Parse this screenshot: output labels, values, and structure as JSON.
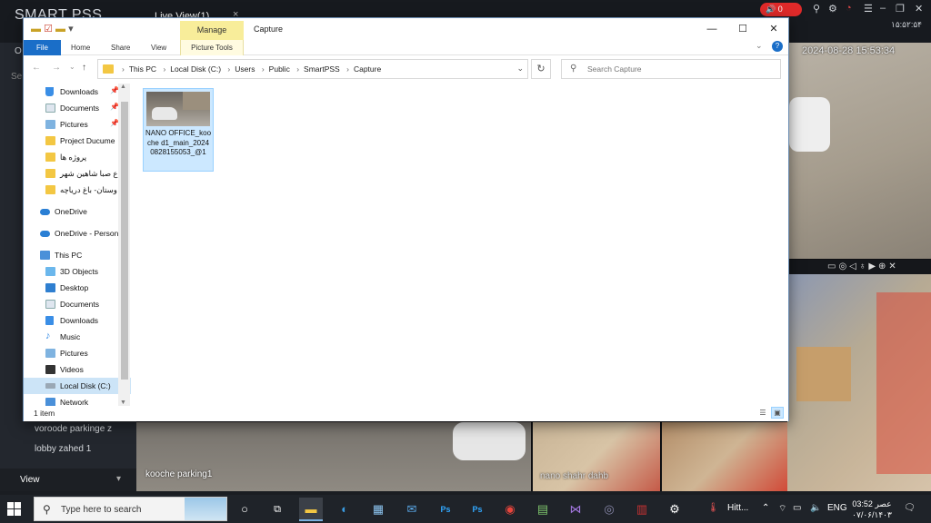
{
  "smartpss": {
    "logo": "SMART PSS",
    "tab_label": "Live View(1)",
    "tab_close": "×",
    "alarm_icon": "speaker-icon",
    "alarm_count": "0",
    "top_icons": [
      "pin-icon",
      "gear-icon",
      "gauge-icon",
      "menu-icon"
    ],
    "window_controls": [
      "minimize-icon",
      "restore-icon",
      "close-icon"
    ],
    "datetime": "۱۵:۵۲:۵۴",
    "left_items": [
      {
        "label": "O"
      },
      {
        "label": "Se"
      },
      {
        "label": "voroode parkinge z"
      },
      {
        "label": "lobby zahed 1"
      }
    ],
    "view_label": "View",
    "view_arrow": "▾",
    "cameras": [
      {
        "label": "kooche parking1"
      },
      {
        "label": "nano shahr dahb"
      }
    ],
    "overlay_timestamp": "2024-08-28 15:53:34"
  },
  "explorer": {
    "title": "Capture",
    "contextual_tab": "Manage",
    "contextual_subtab": "Picture Tools",
    "ribbon_tabs": [
      "File",
      "Home",
      "Share",
      "View"
    ],
    "breadcrumb": [
      "This PC",
      "Local Disk (C:)",
      "Users",
      "Public",
      "SmartPSS",
      "Capture"
    ],
    "search_placeholder": "Search Capture",
    "nav_items": [
      {
        "label": "Downloads",
        "pinned": true,
        "icon": "download-icon"
      },
      {
        "label": "Documents",
        "pinned": true,
        "icon": "documents-icon"
      },
      {
        "label": "Pictures",
        "pinned": true,
        "icon": "pictures-icon"
      },
      {
        "label": "Project Ducume",
        "pinned": false,
        "icon": "folder-icon"
      },
      {
        "label": "پروژه ها",
        "pinned": false,
        "icon": "folder-icon"
      },
      {
        "label": "ع صبا شاهین شهر",
        "pinned": false,
        "icon": "folder-icon"
      },
      {
        "label": "وستان- باغ دریاچه",
        "pinned": false,
        "icon": "folder-icon"
      },
      {
        "label": "OneDrive",
        "pinned": false,
        "icon": "onedrive-icon"
      },
      {
        "label": "OneDrive - Person",
        "pinned": false,
        "icon": "onedrive-icon"
      },
      {
        "label": "This PC",
        "pinned": false,
        "icon": "pc-icon"
      },
      {
        "label": "3D Objects",
        "pinned": false,
        "icon": "cube-icon"
      },
      {
        "label": "Desktop",
        "pinned": false,
        "icon": "desktop-icon"
      },
      {
        "label": "Documents",
        "pinned": false,
        "icon": "documents-icon"
      },
      {
        "label": "Downloads",
        "pinned": false,
        "icon": "download-icon"
      },
      {
        "label": "Music",
        "pinned": false,
        "icon": "music-icon"
      },
      {
        "label": "Pictures",
        "pinned": false,
        "icon": "pictures-icon"
      },
      {
        "label": "Videos",
        "pinned": false,
        "icon": "videos-icon"
      },
      {
        "label": "Local Disk (C:)",
        "pinned": false,
        "icon": "disk-icon",
        "selected": true
      },
      {
        "label": "Network",
        "pinned": false,
        "icon": "network-icon"
      }
    ],
    "files": [
      {
        "name": "NANO OFFICE_kooche d1_main_20240828155053_@1"
      }
    ],
    "status": "1 item"
  },
  "taskbar": {
    "search_placeholder": "Type here to search",
    "apps": [
      "cortana-icon",
      "task-view-icon",
      "file-explorer-icon",
      "edge-icon",
      "store-icon",
      "mail-icon",
      "photoshop-icon",
      "photoshop-icon",
      "chrome-icon",
      "notepad-icon",
      "visual-studio-icon",
      "camera-icon",
      "winrar-icon",
      "settings-icon"
    ],
    "weather_label": "Hitt...",
    "language": "ENG",
    "time": "03:52 عصر",
    "date": "۰۷/۰۶/۱۴۰۳"
  },
  "colors": {
    "accent": "#1a6ec8",
    "manage_tab": "#f8ed9a",
    "selection": "#cce8ff",
    "folder": "#f3c743",
    "alarm": "#e02a2a"
  }
}
